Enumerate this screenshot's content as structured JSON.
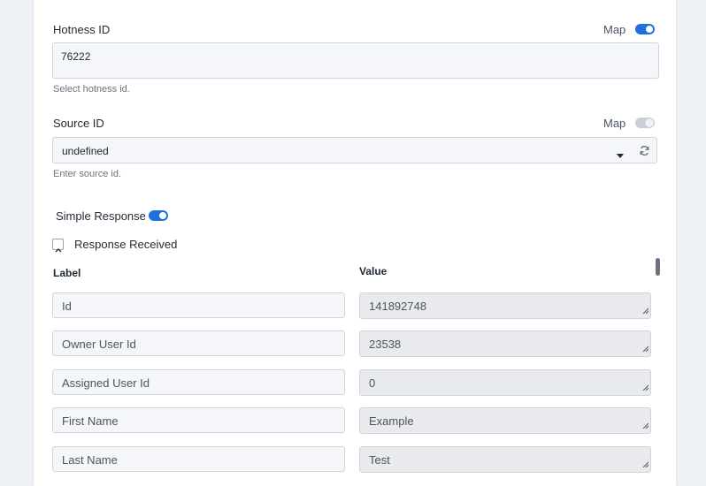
{
  "hotness": {
    "label": "Hotness ID",
    "map_label": "Map",
    "map_on": true,
    "value": "76222",
    "helper": "Select hotness id."
  },
  "source": {
    "label": "Source ID",
    "map_label": "Map",
    "map_on": false,
    "value": "undefined",
    "helper": "Enter source id.",
    "icons": {
      "dropdown": "caret-down-icon",
      "refresh": "refresh-icon"
    }
  },
  "simple_response": {
    "label": "Simple Response",
    "on": true
  },
  "response_received": {
    "label": "Response Received",
    "collapse_icon": "chevron-up-icon"
  },
  "table": {
    "label_header": "Label",
    "value_header": "Value",
    "rows": [
      {
        "label": "Id",
        "value": "141892748"
      },
      {
        "label": "Owner User Id",
        "value": "23538"
      },
      {
        "label": "Assigned User Id",
        "value": "0"
      },
      {
        "label": "First Name",
        "value": "Example"
      },
      {
        "label": "Last Name",
        "value": "Test"
      }
    ]
  },
  "colors": {
    "accent": "#1e6fe0",
    "toggle_off": "#c9cfd8"
  }
}
